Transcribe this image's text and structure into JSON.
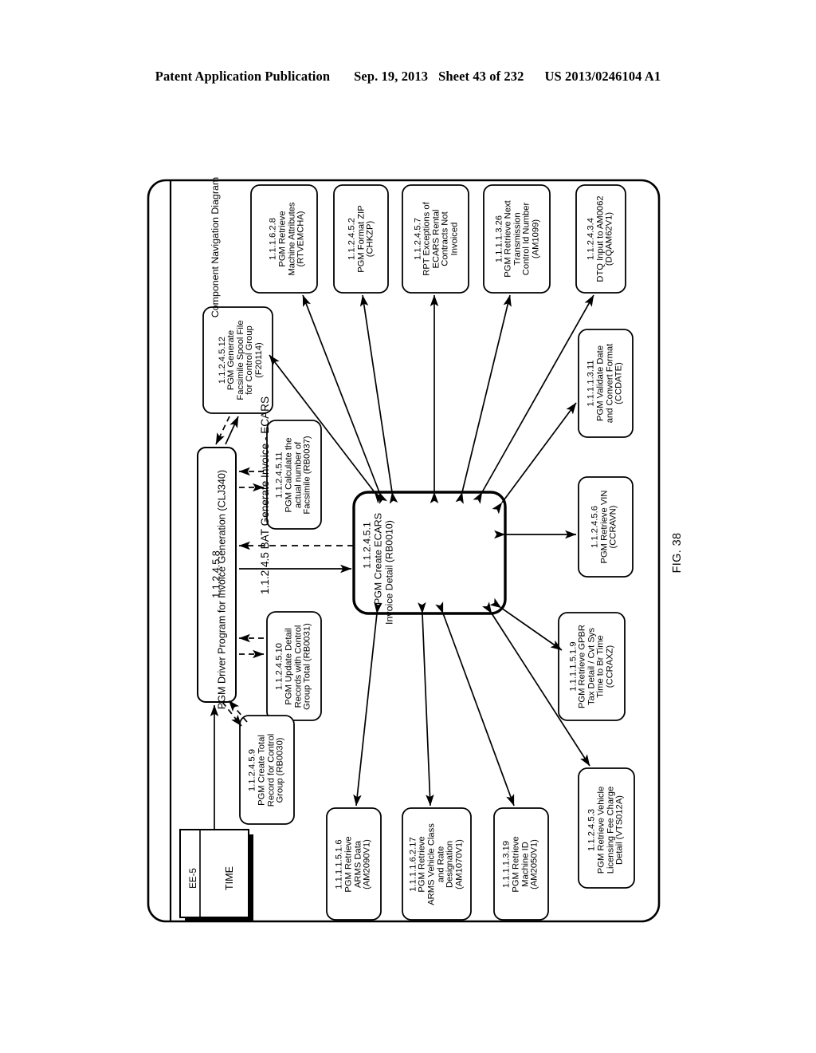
{
  "page_header": {
    "publication": "Patent Application Publication",
    "date": "Sep. 19, 2013",
    "sheet": "Sheet 43 of 232",
    "patent_number": "US 2013/0246104 A1"
  },
  "figure": {
    "label": "FIG. 38",
    "title": "1.1.2.4.5 BAT Generate Invoice - ECARS",
    "subtitle": "Component Navigation Diagram"
  },
  "datastore": {
    "id": "EE-5",
    "name": "TIME"
  },
  "driver": {
    "id": "1.1.2.4.5.8",
    "line1": "PGM Driver Program for Invoice Generation (CLJ340)"
  },
  "center": {
    "id": "1.1.2.4.5.1",
    "line1": "PGM Create ECARS",
    "line2": "Invoice Detail (RB0010)"
  },
  "nodes": [
    {
      "key": "facsimile_spool",
      "id": "1.1.2.4.5.12",
      "lines": [
        "PGM Generate",
        "Facsimile Spool File",
        "for Control Group",
        "(F20114)"
      ]
    },
    {
      "key": "machine_attributes",
      "id": "1.1.1.6.2.8",
      "lines": [
        "PGM Retrieve",
        "Machine Attributes",
        "(RTVEMCHA)"
      ]
    },
    {
      "key": "format_zip",
      "id": "1.1.2.4.5.2",
      "lines": [
        "PGM Format ZIP",
        "(CHKZP)"
      ]
    },
    {
      "key": "rpt_exceptions",
      "id": "1.1.2.4.5.7",
      "lines": [
        "RPT Exceptions of",
        "ECARS Rental",
        "Contracts Not",
        "Invoiced"
      ]
    },
    {
      "key": "next_transmission",
      "id": "1.1.1.1.3.26",
      "lines": [
        "PGM Retrieve Next",
        "Transmission",
        "Control Id Number",
        "(AM1099)"
      ]
    },
    {
      "key": "dtq_input",
      "id": "1.1.2.4.3.4",
      "lines": [
        "DTQ Input to AM0062",
        "(DQAM62V1)"
      ]
    },
    {
      "key": "validate_date",
      "id": "1.1.1.1.3.11",
      "lines": [
        "PGM Validate Date",
        "and Convert Format",
        "(CCDATE)"
      ]
    },
    {
      "key": "retrieve_vin",
      "id": "1.1.2.4.5.6",
      "lines": [
        "PGM Retrieve VIN",
        "(CCRAVN)"
      ]
    },
    {
      "key": "gpbr_tax",
      "id": "1.1.1.1.5.1.9",
      "lines": [
        "PGM Retrieve GPBR",
        "Tax Detail / Cvt Sys",
        "Time to Br Time",
        "(CCRAXZ)"
      ]
    },
    {
      "key": "licensing_fee",
      "id": "1.1.2.4.5.3",
      "lines": [
        "PGM Retrieve Vehicle",
        "Licensing Fee Charge",
        "Detail (VTS012A)"
      ]
    },
    {
      "key": "calc_facsimile",
      "id": "1.1.2.4.5.11",
      "lines": [
        "PGM Calculate the",
        "actual number of",
        "Facsimile (RB0037)"
      ]
    },
    {
      "key": "update_detail",
      "id": "1.1.2.4.5.10",
      "lines": [
        "PGM Update Detail",
        "Records with Control",
        "Group Total (RB0031)"
      ]
    },
    {
      "key": "create_total",
      "id": "1.1.2.4.5.9",
      "lines": [
        "PGM Create Total",
        "Record for Control",
        "Group (RB0030)"
      ]
    },
    {
      "key": "arms_data",
      "id": "1.1.1.1.5.1.6",
      "lines": [
        "PGM Retrieve",
        "ARMS Data",
        "(AM2090V1)"
      ]
    },
    {
      "key": "arms_vehicle_class",
      "id": "1.1.1.1.6.2.17",
      "lines": [
        "PGM Retrieve",
        "ARMS Vehicle Class",
        "and Rate",
        "Designation",
        "(AM1070V1)"
      ]
    },
    {
      "key": "machine_id",
      "id": "1.1.1.1.3.19",
      "lines": [
        "PGM Retrieve",
        "Machine ID",
        "(AM2050V1)"
      ]
    }
  ]
}
